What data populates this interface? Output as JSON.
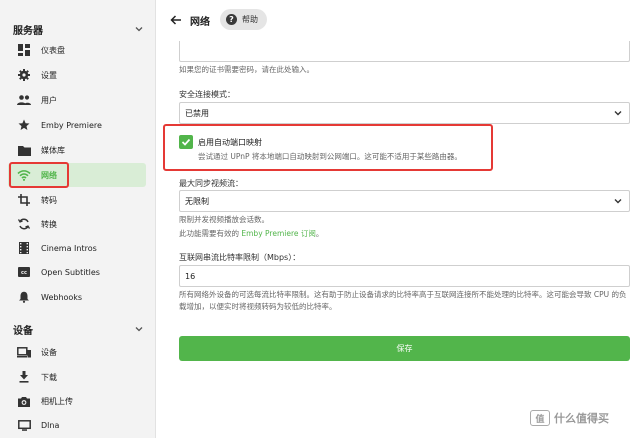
{
  "sidebar": {
    "server_title": "服务器",
    "server_items": [
      {
        "label": "仪表盘",
        "icon": "dashboard-icon"
      },
      {
        "label": "设置",
        "icon": "gear-icon"
      },
      {
        "label": "用户",
        "icon": "users-icon"
      },
      {
        "label": "Emby Premiere",
        "icon": "star-icon"
      },
      {
        "label": "媒体库",
        "icon": "folder-icon"
      },
      {
        "label": "网络",
        "icon": "wifi-icon",
        "active": true
      },
      {
        "label": "转码",
        "icon": "transcode-icon"
      },
      {
        "label": "转换",
        "icon": "convert-icon"
      },
      {
        "label": "Cinema Intros",
        "icon": "film-icon"
      },
      {
        "label": "Open Subtitles",
        "icon": "subtitles-icon"
      },
      {
        "label": "Webhooks",
        "icon": "bell-icon"
      }
    ],
    "devices_title": "设备",
    "device_items": [
      {
        "label": "设备",
        "icon": "devices-icon"
      },
      {
        "label": "下载",
        "icon": "download-icon"
      },
      {
        "label": "相机上传",
        "icon": "camera-icon"
      },
      {
        "label": "Dlna",
        "icon": "dlna-icon"
      }
    ]
  },
  "header": {
    "title": "网络",
    "help_label": "帮助"
  },
  "form": {
    "cert_password_help": "如果您的证书需要密码，请在此处输入。",
    "secure_mode_label": "安全连接模式：",
    "secure_mode_value": "已禁用",
    "upnp_label": "启用自动端口映射",
    "upnp_help": "尝试通过 UPnP 将本地端口自动映射到公网端口。这可能不适用于某些路由器。",
    "max_streams_label": "最大同步视频流：",
    "max_streams_value": "无限制",
    "max_streams_help1": "限制并发视频播放会话数。",
    "max_streams_help2_prefix": "此功能需要有效的 ",
    "max_streams_help2_link": "Emby Premiere 订阅",
    "max_streams_help2_suffix": "。",
    "bitrate_label": "互联网串流比特率限制（Mbps）：",
    "bitrate_value": "16",
    "bitrate_help": "所有网络外设备的可选每流比特率限制。这有助于防止设备请求的比特率高于互联网连接所不能处理的比特率。这可能会导致 CPU 的负载增加，以便实时将视频转码为较低的比特率。",
    "save_label": "保存"
  },
  "watermark": {
    "text": "什么值得买",
    "mark": "值"
  },
  "colors": {
    "accent": "#52b54b",
    "highlight": "#e53935"
  }
}
